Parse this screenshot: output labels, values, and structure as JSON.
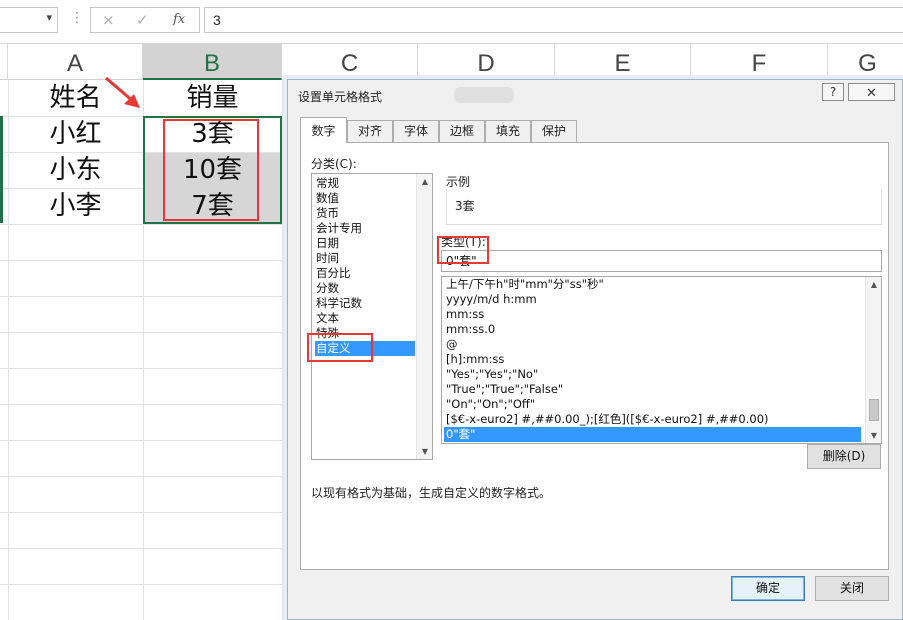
{
  "formula_bar": {
    "name_box": "",
    "value": "3",
    "cancel_icon": "×",
    "enter_icon": "✓",
    "fx_label": "fx"
  },
  "sheet": {
    "columns": [
      "A",
      "B",
      "C",
      "D",
      "E",
      "F",
      "G"
    ],
    "selected_column": "B",
    "cells": {
      "A1": "姓名",
      "B1": "销量",
      "A2": "小红",
      "B2": "3套",
      "A3": "小东",
      "B3": "10套",
      "A4": "小李",
      "B4": "7套"
    },
    "selection_color": "#217346",
    "highlight_color": "#e53935"
  },
  "dialog": {
    "title": "设置单元格格式",
    "help_label": "?",
    "close_icon": "✕",
    "tabs": [
      {
        "label": "数字",
        "active": true
      },
      {
        "label": "对齐",
        "active": false
      },
      {
        "label": "字体",
        "active": false
      },
      {
        "label": "边框",
        "active": false
      },
      {
        "label": "填充",
        "active": false
      },
      {
        "label": "保护",
        "active": false
      }
    ],
    "category_label": "分类(C):",
    "categories": [
      "常规",
      "数值",
      "货币",
      "会计专用",
      "日期",
      "时间",
      "百分比",
      "分数",
      "科学记数",
      "文本",
      "特殊",
      "自定义"
    ],
    "selected_category": "自定义",
    "sample_label": "示例",
    "sample_value": "3套",
    "type_label": "类型(T):",
    "type_value": "0\"套\"",
    "formats": [
      "上午/下午h\"时\"mm\"分\"ss\"秒\"",
      "yyyy/m/d h:mm",
      "mm:ss",
      "mm:ss.0",
      "@",
      "[h]:mm:ss",
      "\"Yes\";\"Yes\";\"No\"",
      "\"True\";\"True\";\"False\"",
      "\"On\";\"On\";\"Off\"",
      "[$€-x-euro2] #,##0.00_);[红色]([$€-x-euro2] #,##0.00)",
      "0\"套\""
    ],
    "selected_format": "0\"套\"",
    "delete_label": "删除(D)",
    "description": "以现有格式为基础，生成自定义的数字格式。",
    "ok_label": "确定",
    "cancel_label": "关闭"
  }
}
